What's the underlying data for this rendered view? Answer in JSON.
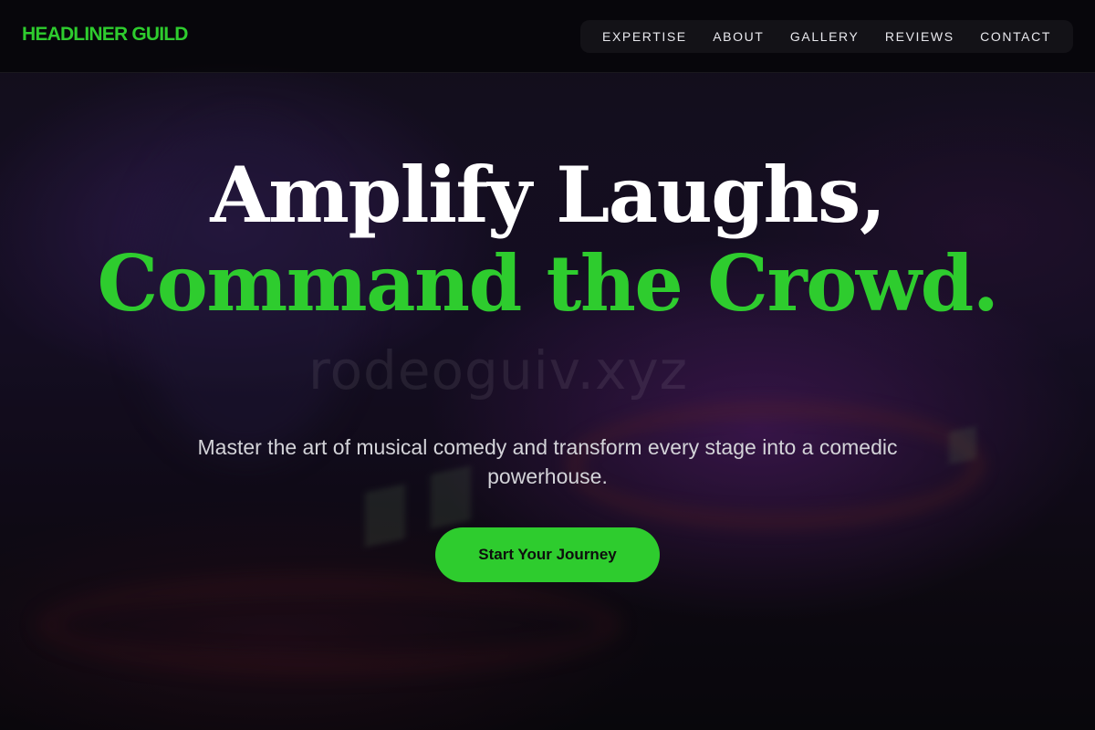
{
  "brand": {
    "logo_text": "HEADLINER GUILD",
    "accent_color": "#2ecc2e"
  },
  "nav": {
    "items": [
      {
        "label": "EXPERTISE"
      },
      {
        "label": "ABOUT"
      },
      {
        "label": "GALLERY"
      },
      {
        "label": "REVIEWS"
      },
      {
        "label": "CONTACT"
      }
    ]
  },
  "hero": {
    "headline_line1": "Amplify Laughs,",
    "headline_line2": "Command the Crowd.",
    "subtitle": "Master the art of musical comedy and transform every stage into a comedic powerhouse.",
    "cta_label": "Start Your Journey",
    "watermark_text": "rodeoguiv.xyz",
    "background_image": "blurred-dj-mixer-photo"
  }
}
